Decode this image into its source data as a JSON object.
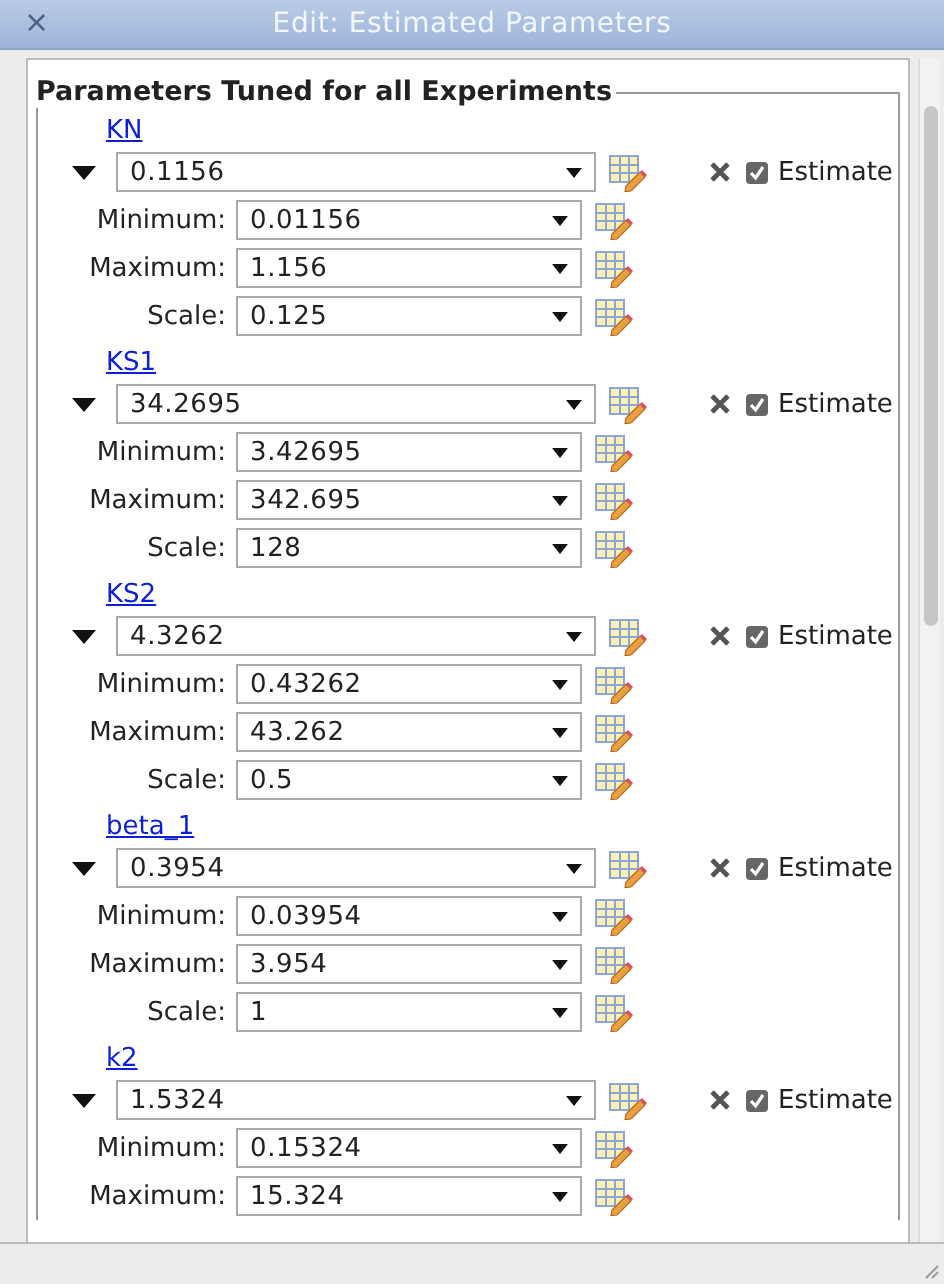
{
  "window": {
    "title": "Edit: Estimated Parameters",
    "close_icon": "×"
  },
  "section": {
    "title": "Parameters Tuned for all Experiments"
  },
  "parameters": [
    {
      "name": "KN",
      "expanded": true,
      "value": "0.1156",
      "estimate": {
        "label": "Estimate",
        "checked": true
      },
      "bounds": [
        {
          "label": "Minimum:",
          "value": "0.01156"
        },
        {
          "label": "Maximum:",
          "value": "1.156"
        },
        {
          "label": "Scale:",
          "value": "0.125"
        }
      ]
    },
    {
      "name": "KS1",
      "expanded": true,
      "value": "34.2695",
      "estimate": {
        "label": "Estimate",
        "checked": true
      },
      "bounds": [
        {
          "label": "Minimum:",
          "value": "3.42695"
        },
        {
          "label": "Maximum:",
          "value": "342.695"
        },
        {
          "label": "Scale:",
          "value": "128"
        }
      ]
    },
    {
      "name": "KS2",
      "expanded": true,
      "value": "4.3262",
      "estimate": {
        "label": "Estimate",
        "checked": true
      },
      "bounds": [
        {
          "label": "Minimum:",
          "value": "0.43262"
        },
        {
          "label": "Maximum:",
          "value": "43.262"
        },
        {
          "label": "Scale:",
          "value": "0.5"
        }
      ]
    },
    {
      "name": "beta_1",
      "expanded": true,
      "value": "0.3954",
      "estimate": {
        "label": "Estimate",
        "checked": true
      },
      "bounds": [
        {
          "label": "Minimum:",
          "value": "0.03954"
        },
        {
          "label": "Maximum:",
          "value": "3.954"
        },
        {
          "label": "Scale:",
          "value": "1"
        }
      ]
    },
    {
      "name": "k2",
      "expanded": true,
      "value": "1.5324",
      "estimate": {
        "label": "Estimate",
        "checked": true
      },
      "bounds": [
        {
          "label": "Minimum:",
          "value": "0.15324"
        },
        {
          "label": "Maximum:",
          "value": "15.324"
        }
      ]
    }
  ]
}
